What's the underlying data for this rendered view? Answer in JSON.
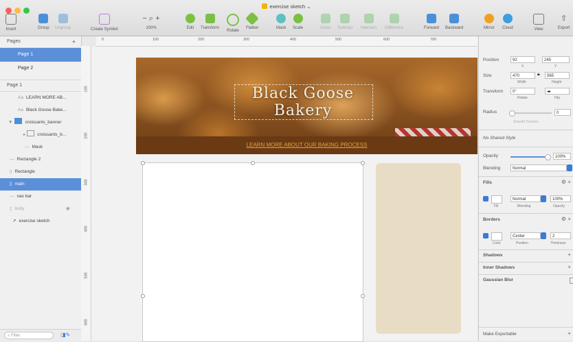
{
  "window": {
    "title": "exercise sketch",
    "title_arrow": "⌄"
  },
  "toolbar": {
    "insert": "Insert",
    "group": "Group",
    "ungroup": "Ungroup",
    "create_symbol": "Create Symbol",
    "zoom_minus": "−",
    "zoom_plus": "+",
    "zoom": "100%",
    "edit": "Edit",
    "transform": "Transform",
    "rotate": "Rotate",
    "flatten": "Flatten",
    "mask": "Mask",
    "scale": "Scale",
    "union": "Union",
    "subtract": "Subtract",
    "intersect": "Intersect",
    "difference": "Difference",
    "forward": "Forward",
    "backward": "Backward",
    "mirror": "Mirror",
    "cloud": "Cloud",
    "view": "View",
    "export": "Export"
  },
  "ruler": {
    "h_marks": [
      "0",
      "100",
      "200",
      "300",
      "400",
      "500",
      "600",
      "700"
    ],
    "v_marks": [
      "100",
      "200",
      "300",
      "400",
      "500",
      "600"
    ]
  },
  "pages": {
    "header": "Pages",
    "add": "+",
    "items": [
      {
        "label": "Page 1",
        "selected": true
      },
      {
        "label": "Page 2",
        "selected": false
      }
    ]
  },
  "layers": {
    "page_label": "Page 1",
    "items": [
      {
        "label": "LEARN MORE AB...",
        "prefix": "Aa"
      },
      {
        "label": "Black Goose Bake...",
        "prefix": "Aa"
      },
      {
        "label": "croissants_banner",
        "prefix": "▼"
      },
      {
        "label": "croissants_b...",
        "prefix": "▸"
      },
      {
        "label": "Mask",
        "prefix": "—"
      },
      {
        "label": "Rectangle 2",
        "prefix": "—"
      },
      {
        "label": "Rectangle",
        "prefix": "▯"
      },
      {
        "label": "main",
        "prefix": "▯"
      },
      {
        "label": "nav bar",
        "prefix": "—"
      },
      {
        "label": "body",
        "prefix": "▯"
      },
      {
        "label": "exercise sketch",
        "prefix": "↗"
      }
    ],
    "filter_placeholder": "Filter"
  },
  "canvas": {
    "hero_title": "Black Goose Bakery",
    "nav_link": "LEARN MORE ABOUT OUR BAKING PROCESS"
  },
  "inspector": {
    "position": "Position",
    "x": "92",
    "y": "245",
    "x_lbl": "X",
    "y_lbl": "Y",
    "size": "Size",
    "width": "470",
    "height": "565",
    "width_lbl": "Width",
    "height_lbl": "Height",
    "transform": "Transform",
    "rotate": "0°",
    "rotate_lbl": "Rotate",
    "flip_lbl": "Flip",
    "radius": "Radius",
    "radius_val": "0",
    "smooth": "Smooth Corners",
    "shared_style": "No Shared Style",
    "opacity": "Opacity",
    "opacity_val": "100%",
    "blending": "Blending",
    "blending_val": "Normal",
    "fills": "Fills",
    "fill_blend": "Normal",
    "fill_opacity": "100%",
    "fill_lbl": "Fill",
    "fill_blend_lbl": "Blending",
    "fill_op_lbl": "Opacity",
    "borders": "Borders",
    "border_pos": "Center",
    "border_thick": "2",
    "color_lbl": "Color",
    "position_lbl": "Position",
    "thickness_lbl": "Thickness",
    "shadows": "Shadows",
    "inner_shadows": "Inner Shadows",
    "gaussian": "Gaussian Blur",
    "make_exportable": "Make Exportable"
  }
}
